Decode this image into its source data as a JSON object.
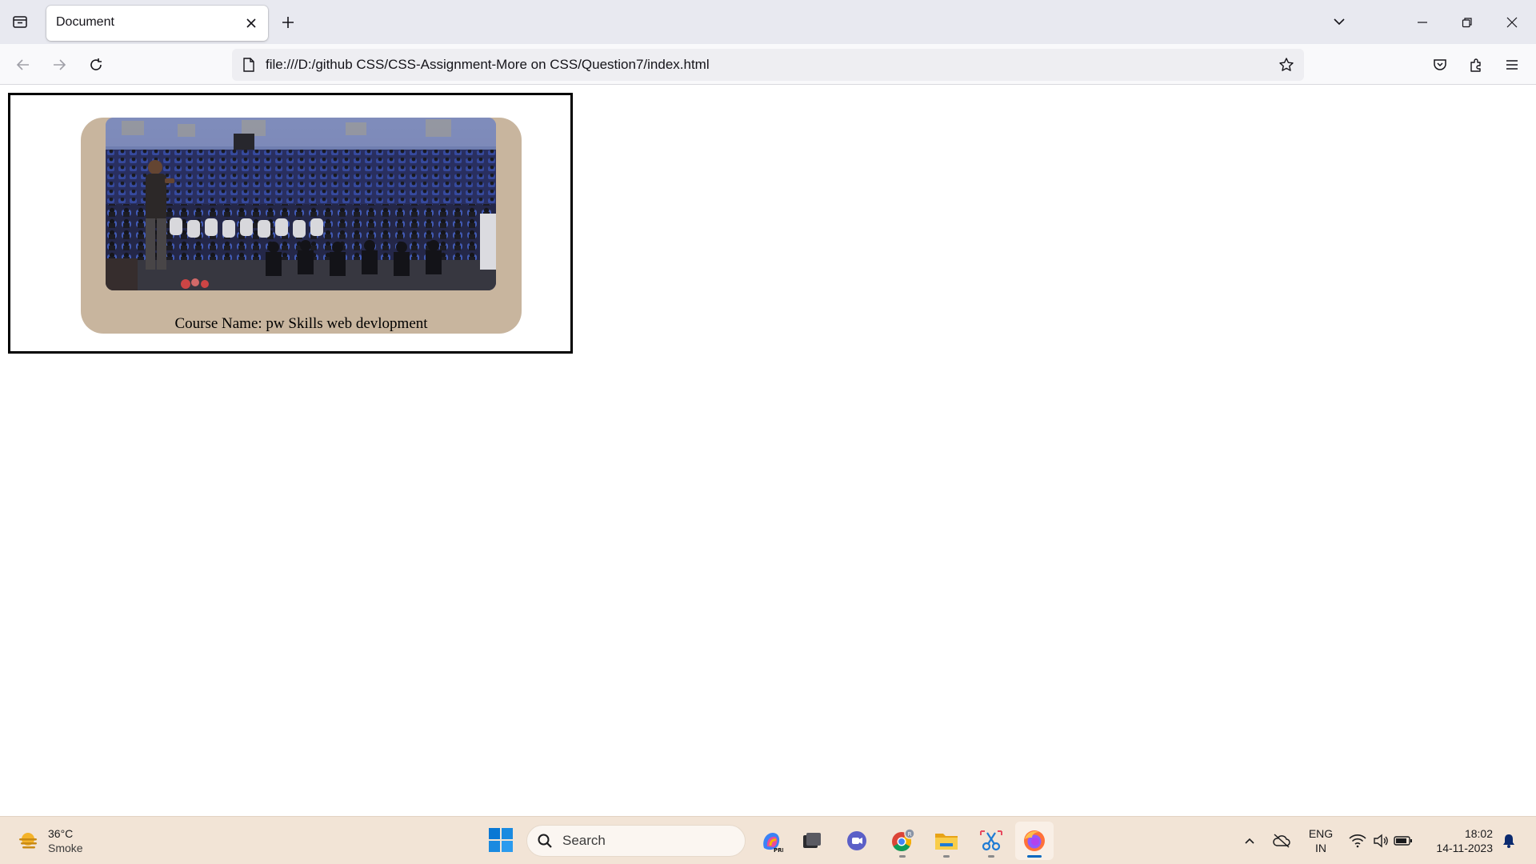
{
  "browser": {
    "tab_title": "Document",
    "url": "file:///D:/github CSS/CSS-Assignment-More on CSS/Question7/index.html"
  },
  "page": {
    "card": {
      "caption": "Course Name: pw Skills web devlopment",
      "image_subject": "speaker-addressing-auditorium-audience"
    }
  },
  "taskbar": {
    "weather": {
      "temperature": "36°C",
      "condition": "Smoke"
    },
    "search_label": "Search",
    "apps": [
      "copilot-icon",
      "task-view-icon",
      "teams-chat-icon",
      "chrome-icon",
      "file-explorer-icon",
      "snipping-tool-icon",
      "firefox-icon"
    ],
    "active_app": "firefox-icon",
    "language": {
      "line1": "ENG",
      "line2": "IN"
    },
    "clock": {
      "time": "18:02",
      "date": "14-11-2023"
    }
  },
  "colors": {
    "card_background": "#c8b59e",
    "taskbar_background": "#f2e4d6",
    "tab_strip": "#e8e9f0"
  }
}
